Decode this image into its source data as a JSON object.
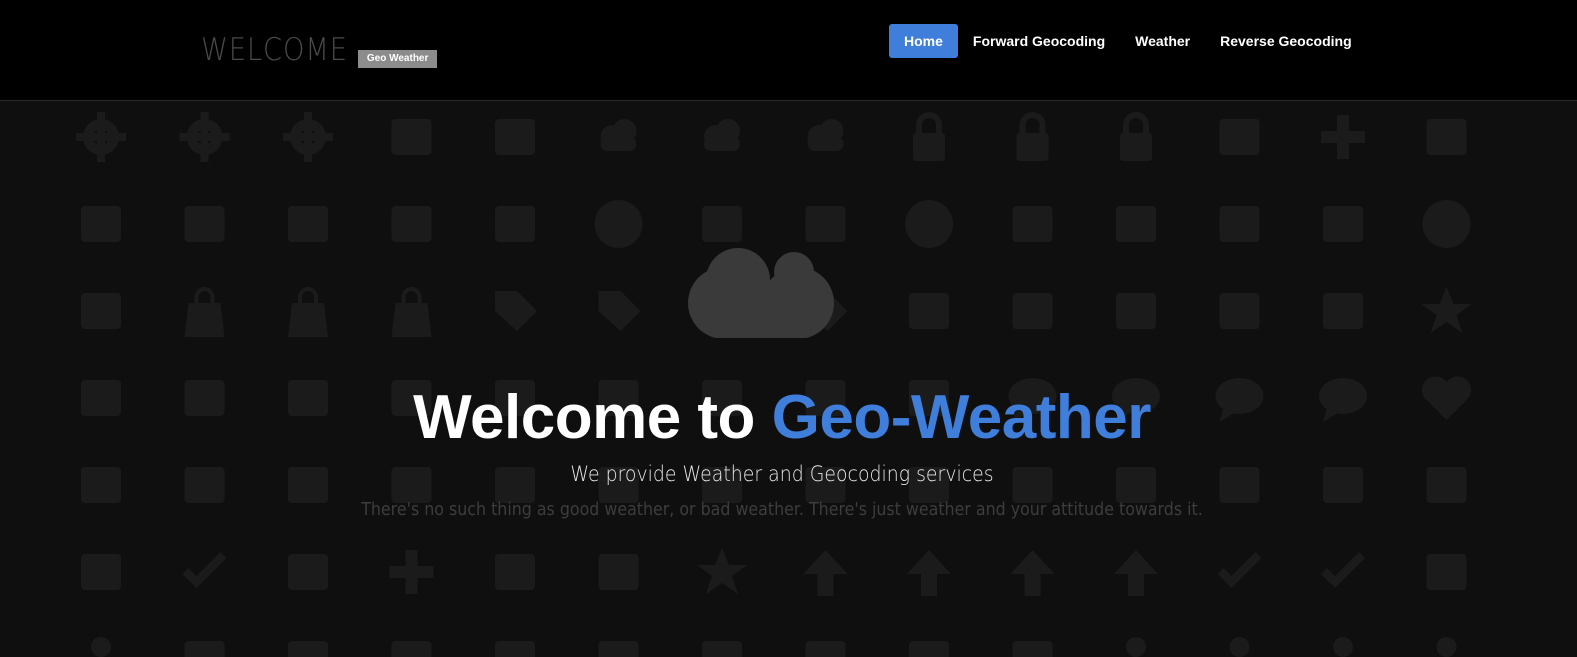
{
  "header": {
    "brand_title": "WELCOME",
    "brand_badge": "Geo Weather",
    "nav": [
      {
        "label": "Home",
        "active": true
      },
      {
        "label": "Forward Geocoding",
        "active": false
      },
      {
        "label": "Weather",
        "active": false
      },
      {
        "label": "Reverse Geocoding",
        "active": false
      }
    ]
  },
  "hero": {
    "title_prefix": "Welcome to ",
    "title_accent": "Geo-Weather",
    "subtitle": "We provide Weather and Geocoding services",
    "quote": "There's no such thing as good weather, or bad weather. There's just weather and your attitude towards it.",
    "hero_icon": "cloud-icon"
  },
  "background_icons": [
    [
      "gear-icon",
      "gear-icon",
      "gear-icon",
      "gamepad-icon",
      "cassette-icon",
      "cloud-upload-icon",
      "cloud-download-icon",
      "cloud-icon",
      "unlock-icon",
      "unlock-icon",
      "lock-icon",
      "pill-icon",
      "medkit-icon",
      "dumbbell-icon"
    ],
    [
      "thumbs-up-icon",
      "thumbs-down-icon",
      "facebook-icon",
      "share-icon",
      "twitter-icon",
      "dribbble-icon",
      "instagram-icon",
      "instagram-icon",
      "camera-icon",
      "film-icon",
      "video-camera-icon",
      "tv-icon",
      "browser-window-icon",
      "eye-icon"
    ],
    [
      "home-icon",
      "shopping-bag-icon",
      "shopping-bag-icon",
      "basket-icon",
      "tag-minus-icon",
      "tag-plus-icon",
      "tag-icon",
      "tag-icon",
      "credit-card-icon",
      "credit-card-icon",
      "credit-card-icon",
      "flag-icon",
      "flag-icon",
      "diamond-icon"
    ],
    [
      "headphones-icon",
      "volume-down-icon",
      "volume-off-icon",
      "volume-up-icon",
      "rss-icon",
      "microphone-icon",
      "microphone-icon",
      "inbox-icon",
      "book-icon",
      "chat-bubble-icon",
      "chat-dots-icon",
      "chat-square-icon",
      "chat-dots-square-icon",
      "heart-icon"
    ],
    [
      "glass-icon",
      "wine-glass-icon",
      "wine-glass-tipped-icon",
      "cocktail-icon",
      "cupcake-icon",
      "beer-icon",
      "coffee-icon",
      "fries-icon",
      "bread-icon",
      "cake-icon",
      "barber-pole-icon",
      "popsicle-icon",
      "ice-cream-icon",
      "drumstick-icon"
    ],
    [
      "bookmark-icon",
      "check-icon",
      "x-icon",
      "plus-icon",
      "minus-icon",
      "external-link-icon",
      "star-icon",
      "arrow-down-icon",
      "arrow-up-icon",
      "arrow-right-icon",
      "arrow-left-icon",
      "laptop-check-icon",
      "checkbox-icon",
      "warning-icon"
    ],
    [
      "user-icon",
      "list-icon",
      "grid-icon",
      "list-icon",
      "grid-icon",
      "grid-icon",
      "crop-icon",
      "vector-icon",
      "calendar-icon",
      "calendar-icon",
      "user-icon",
      "users-icon",
      "user-icon",
      "user-icon"
    ]
  ],
  "colors": {
    "accent": "#3f7fdb",
    "header_bg": "#000000",
    "hero_bg": "#0f0f0f",
    "pattern_icon": "#1b1b1b",
    "hero_cloud": "#3a3a3a",
    "badge_bg": "#8c8c8c"
  }
}
